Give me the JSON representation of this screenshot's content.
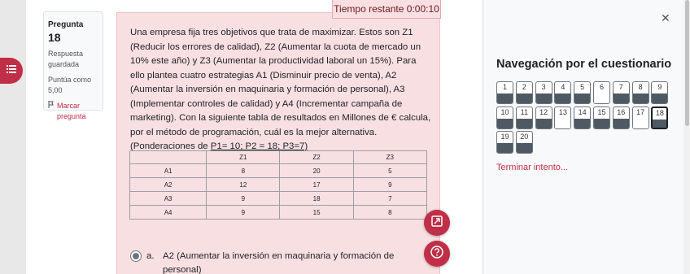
{
  "timer": {
    "label": "Tiempo restante 0:00:10"
  },
  "question_info": {
    "label": "Pregunta",
    "number": "18",
    "state": "Respuesta guardada",
    "grade": "Puntúa como 5,00",
    "flag": "Marcar pregunta"
  },
  "question": {
    "text_main": "Una empresa fija tres objetivos que trata de maximizar. Estos son Z1 (Reducir los errores de calidad), Z2 (Aumentar la cuota de mercado un 10% este año) y Z3 (Aumentar la productividad laboral un 15%). Para ello plantea cuatro estrategias A1 (Disminuir precio de venta), A2 (Aumentar la inversión en maquinaria y formación de personal), A3 (Implementar controles de calidad) y A4 (Incrementar campaña de marketing). Con la siguiente tabla de resultados en Millones de € calcula, por el método de programación, cuál es la mejor alternativa. (Ponderaciones de ",
    "text_weights": "P1= 10; P2 = 18; P3=7)",
    "table": {
      "headers": [
        "",
        "Z1",
        "Z2",
        "Z3"
      ],
      "rows": [
        [
          "A1",
          "8",
          "20",
          "5"
        ],
        [
          "A2",
          "12",
          "17",
          "9"
        ],
        [
          "A3",
          "9",
          "18",
          "7"
        ],
        [
          "A4",
          "9",
          "15",
          "8"
        ]
      ]
    },
    "answer": {
      "letter": "a.",
      "text": "A2 (Aumentar la inversión en maquinaria y formación de personal)"
    }
  },
  "nav": {
    "title": "Navegación por el cuestionario",
    "buttons": [
      {
        "num": "1",
        "answered": true
      },
      {
        "num": "2",
        "answered": true
      },
      {
        "num": "3",
        "answered": true
      },
      {
        "num": "4",
        "answered": true
      },
      {
        "num": "5",
        "answered": true
      },
      {
        "num": "6",
        "answered": false
      },
      {
        "num": "7",
        "answered": true
      },
      {
        "num": "8",
        "answered": true
      },
      {
        "num": "9",
        "answered": true
      },
      {
        "num": "10",
        "answered": true
      },
      {
        "num": "11",
        "answered": true
      },
      {
        "num": "12",
        "answered": true
      },
      {
        "num": "13",
        "answered": false
      },
      {
        "num": "14",
        "answered": true
      },
      {
        "num": "15",
        "answered": true
      },
      {
        "num": "16",
        "answered": true
      },
      {
        "num": "17",
        "answered": false
      },
      {
        "num": "18",
        "answered": true,
        "current": true
      },
      {
        "num": "19",
        "answered": true
      },
      {
        "num": "20",
        "answered": true
      }
    ],
    "finish_label": "Terminar intento..."
  },
  "colors": {
    "accent": "#c02e47",
    "answered": "#4f5963",
    "panel": "#f8dfe2"
  },
  "icons": {
    "drawer": "list-icon",
    "fullscreen": "expand-icon",
    "help": "question-icon",
    "close": "close-icon",
    "flag": "flag-icon"
  }
}
